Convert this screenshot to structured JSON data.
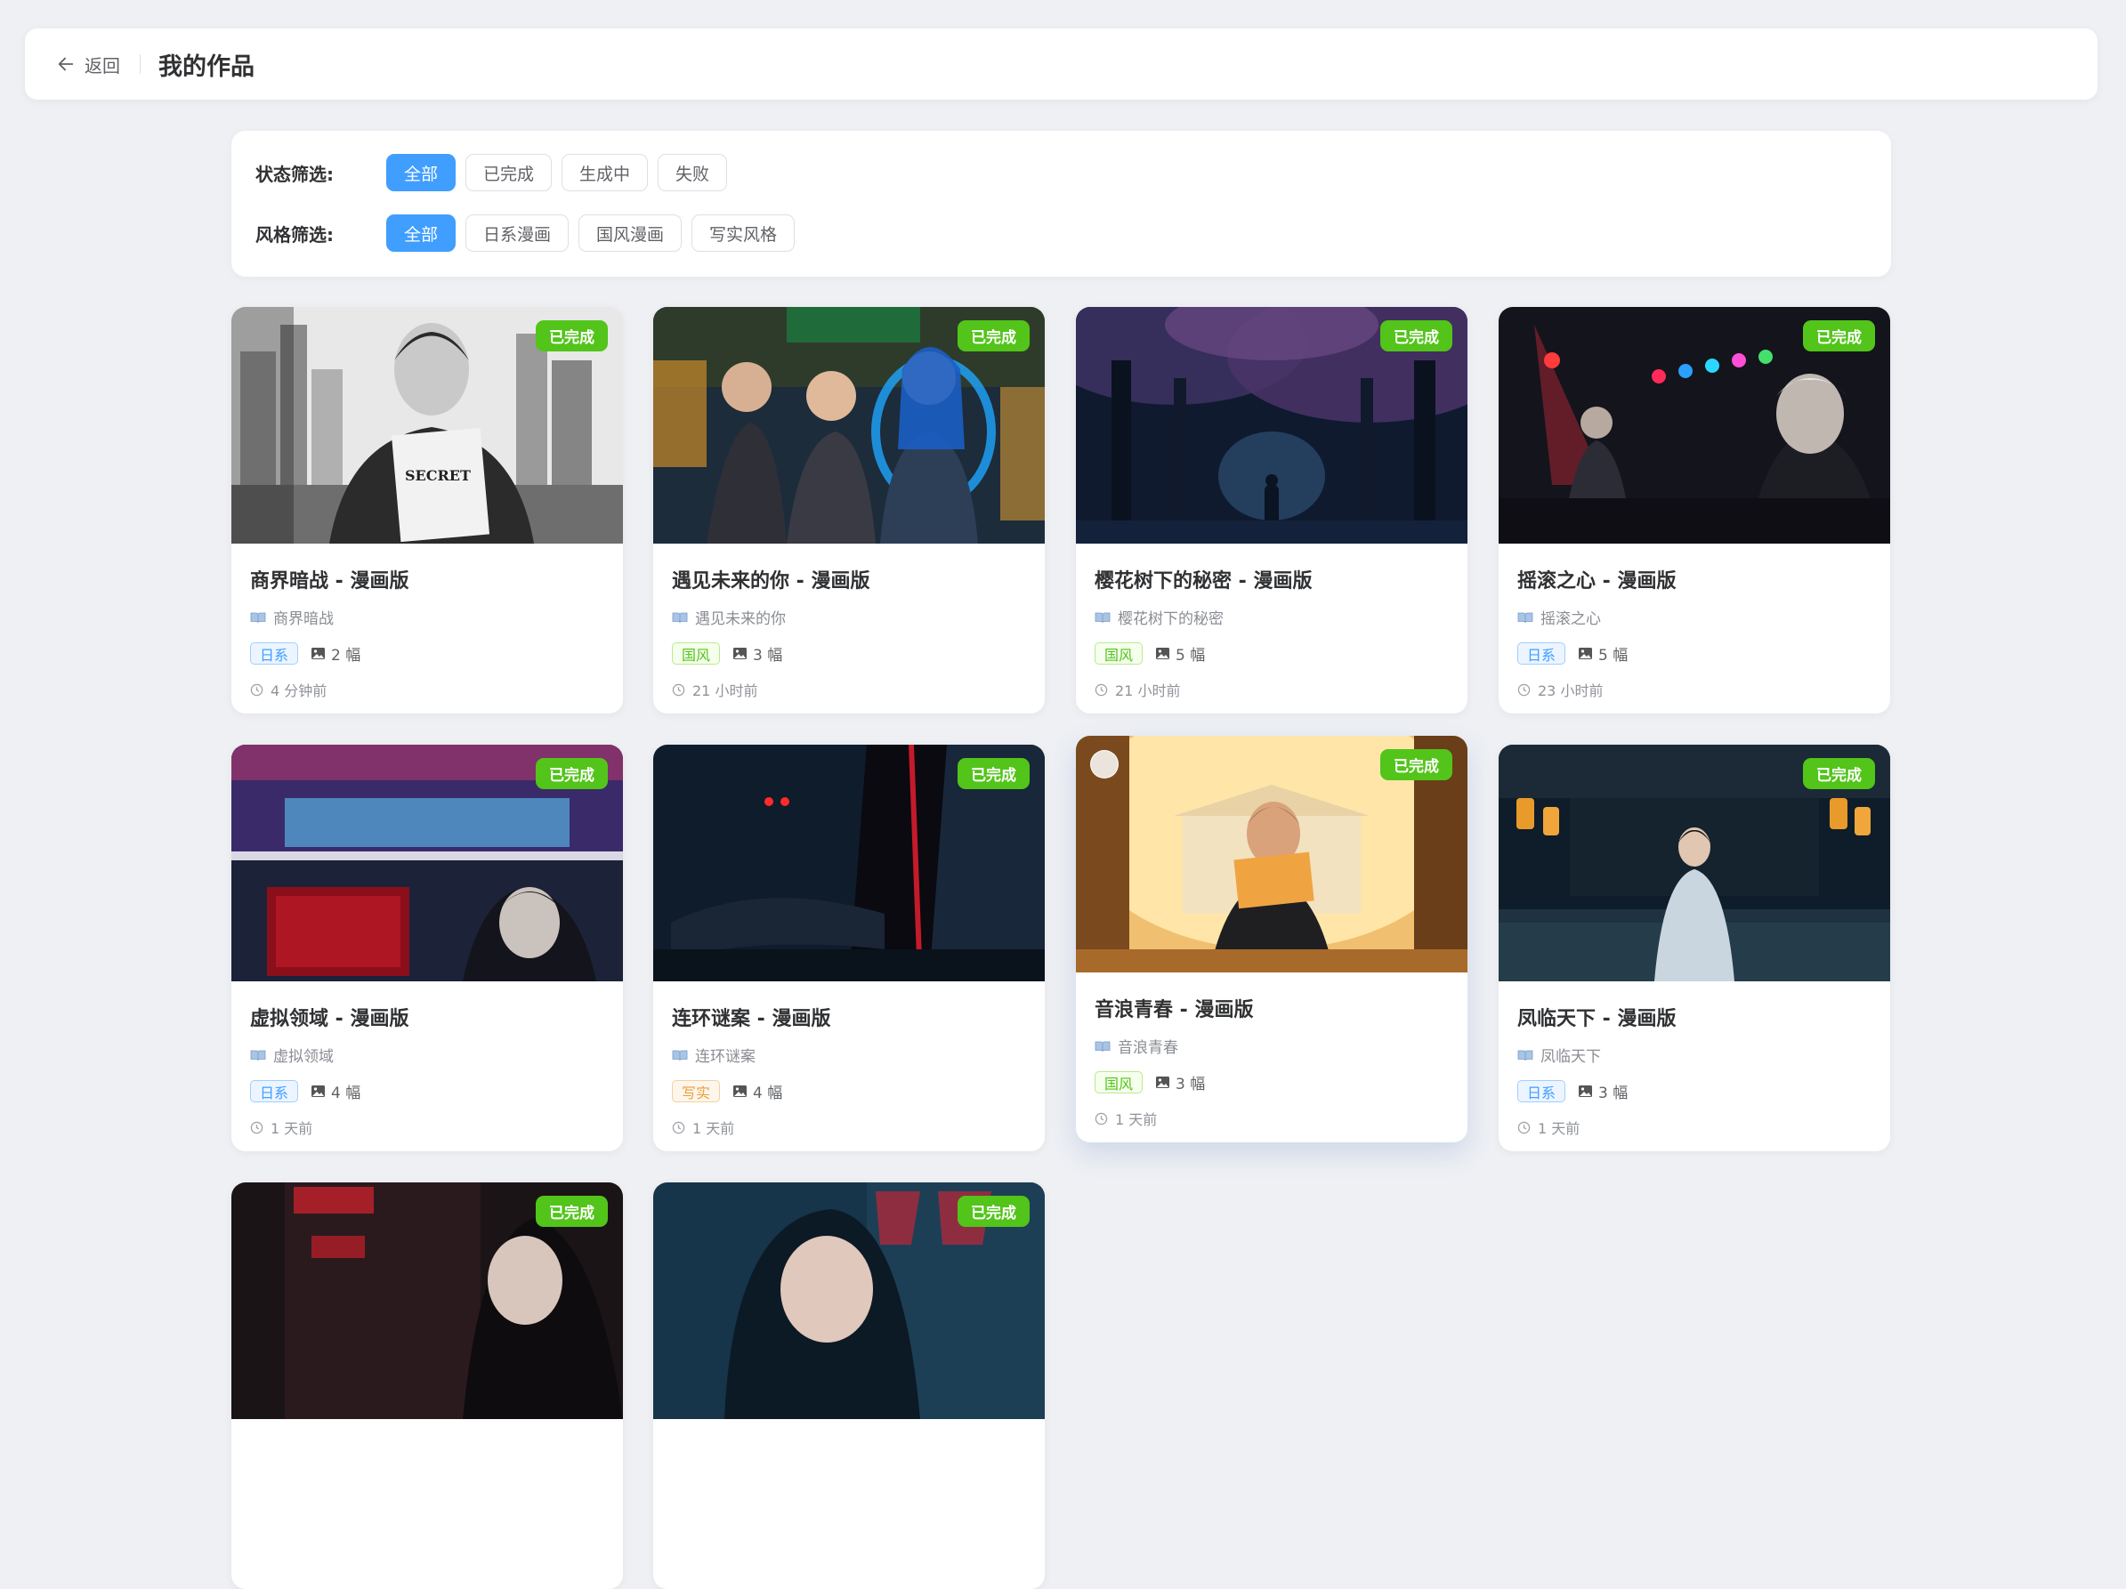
{
  "header": {
    "back_label": "返回",
    "title": "我的作品"
  },
  "filters": {
    "status": {
      "label": "状态筛选:",
      "options": [
        "全部",
        "已完成",
        "生成中",
        "失败"
      ],
      "active": "全部"
    },
    "style": {
      "label": "风格筛选:",
      "options": [
        "全部",
        "日系漫画",
        "国风漫画",
        "写实风格"
      ],
      "active": "全部"
    }
  },
  "works": [
    {
      "title": "商界暗战 - 漫画版",
      "source": "商界暗战",
      "style": "日系",
      "count": "2 幅",
      "time": "4 分钟前",
      "status": "已完成"
    },
    {
      "title": "遇见未来的你 - 漫画版",
      "source": "遇见未来的你",
      "style": "国风",
      "count": "3 幅",
      "time": "21 小时前",
      "status": "已完成"
    },
    {
      "title": "樱花树下的秘密 - 漫画版",
      "source": "樱花树下的秘密",
      "style": "国风",
      "count": "5 幅",
      "time": "21 小时前",
      "status": "已完成"
    },
    {
      "title": "摇滚之心 - 漫画版",
      "source": "摇滚之心",
      "style": "日系",
      "count": "5 幅",
      "time": "23 小时前",
      "status": "已完成"
    },
    {
      "title": "虚拟领域 - 漫画版",
      "source": "虚拟领域",
      "style": "日系",
      "count": "4 幅",
      "time": "1 天前",
      "status": "已完成"
    },
    {
      "title": "连环谜案 - 漫画版",
      "source": "连环谜案",
      "style": "写实",
      "count": "4 幅",
      "time": "1 天前",
      "status": "已完成"
    },
    {
      "title": "音浪青春 - 漫画版",
      "source": "音浪青春",
      "style": "国风",
      "count": "3 幅",
      "time": "1 天前",
      "status": "已完成"
    },
    {
      "title": "凤临天下 - 漫画版",
      "source": "凤临天下",
      "style": "日系",
      "count": "3 幅",
      "time": "1 天前",
      "status": "已完成"
    },
    {
      "status": "已完成"
    },
    {
      "status": "已完成"
    }
  ],
  "colors": {
    "accent": "#409eff",
    "success": "#52c41a",
    "tag_ja": "#409eff",
    "tag_cn": "#52c41a",
    "tag_real": "#e6a23c"
  }
}
